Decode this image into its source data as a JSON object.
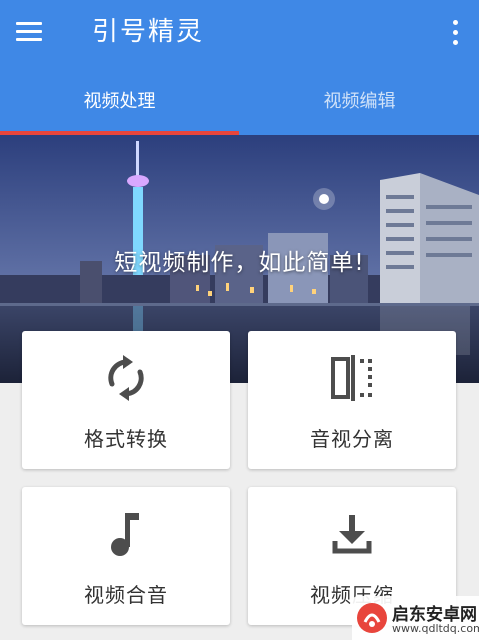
{
  "app_bar": {
    "title": "引号精灵",
    "menu_icon": "hamburger-menu-icon",
    "more_icon": "more-vertical-icon",
    "color": "#3f88e6"
  },
  "tabs": [
    {
      "label": "视频处理",
      "active": true
    },
    {
      "label": "视频编辑",
      "active": false
    }
  ],
  "tab_indicator_color": "#e8453c",
  "banner": {
    "text": "短视频制作，如此简单!",
    "image": "city-night-skyline"
  },
  "cards": [
    {
      "label": "格式转换",
      "icon": "sync-icon"
    },
    {
      "label": "音视分离",
      "icon": "split-icon"
    },
    {
      "label": "视频合音",
      "icon": "music-note-icon"
    },
    {
      "label": "视频压缩",
      "icon": "download-icon"
    }
  ],
  "watermark": {
    "name": "启东安卓网",
    "url": "www.qdltdq.com"
  }
}
